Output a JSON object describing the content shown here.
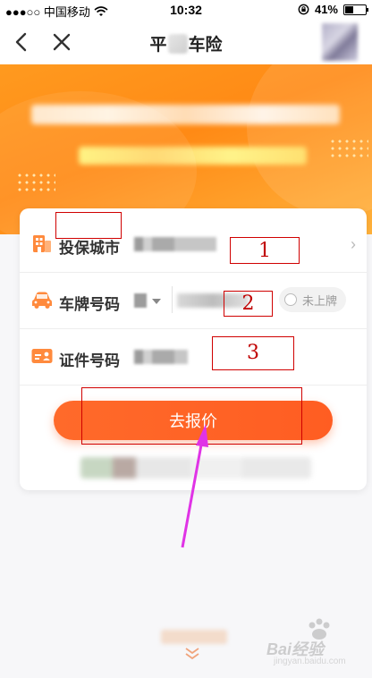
{
  "status_bar": {
    "carrier": "●●●○○ 中国移动",
    "time": "10:32",
    "battery_text": "41%",
    "battery_level": 0.41
  },
  "nav": {
    "title_prefix": "平",
    "title_suffix": "车险"
  },
  "form": {
    "rows": [
      {
        "icon": "building-icon",
        "label": "投保城市"
      },
      {
        "icon": "car-icon",
        "label": "车牌号码",
        "unplated_label": "未上牌"
      },
      {
        "icon": "id-card-icon",
        "label": "证件号码"
      }
    ],
    "submit_label": "去报价"
  },
  "annotations": [
    "1",
    "2",
    "3"
  ],
  "colors": {
    "accent": "#ff6228",
    "banner": "#ff9a1f",
    "annotation": "#d00000",
    "arrow": "#e033e6",
    "icon": "#ff8a3d"
  },
  "watermark": {
    "text": "Bai经验",
    "sub": "jingyan.baidu.com"
  }
}
